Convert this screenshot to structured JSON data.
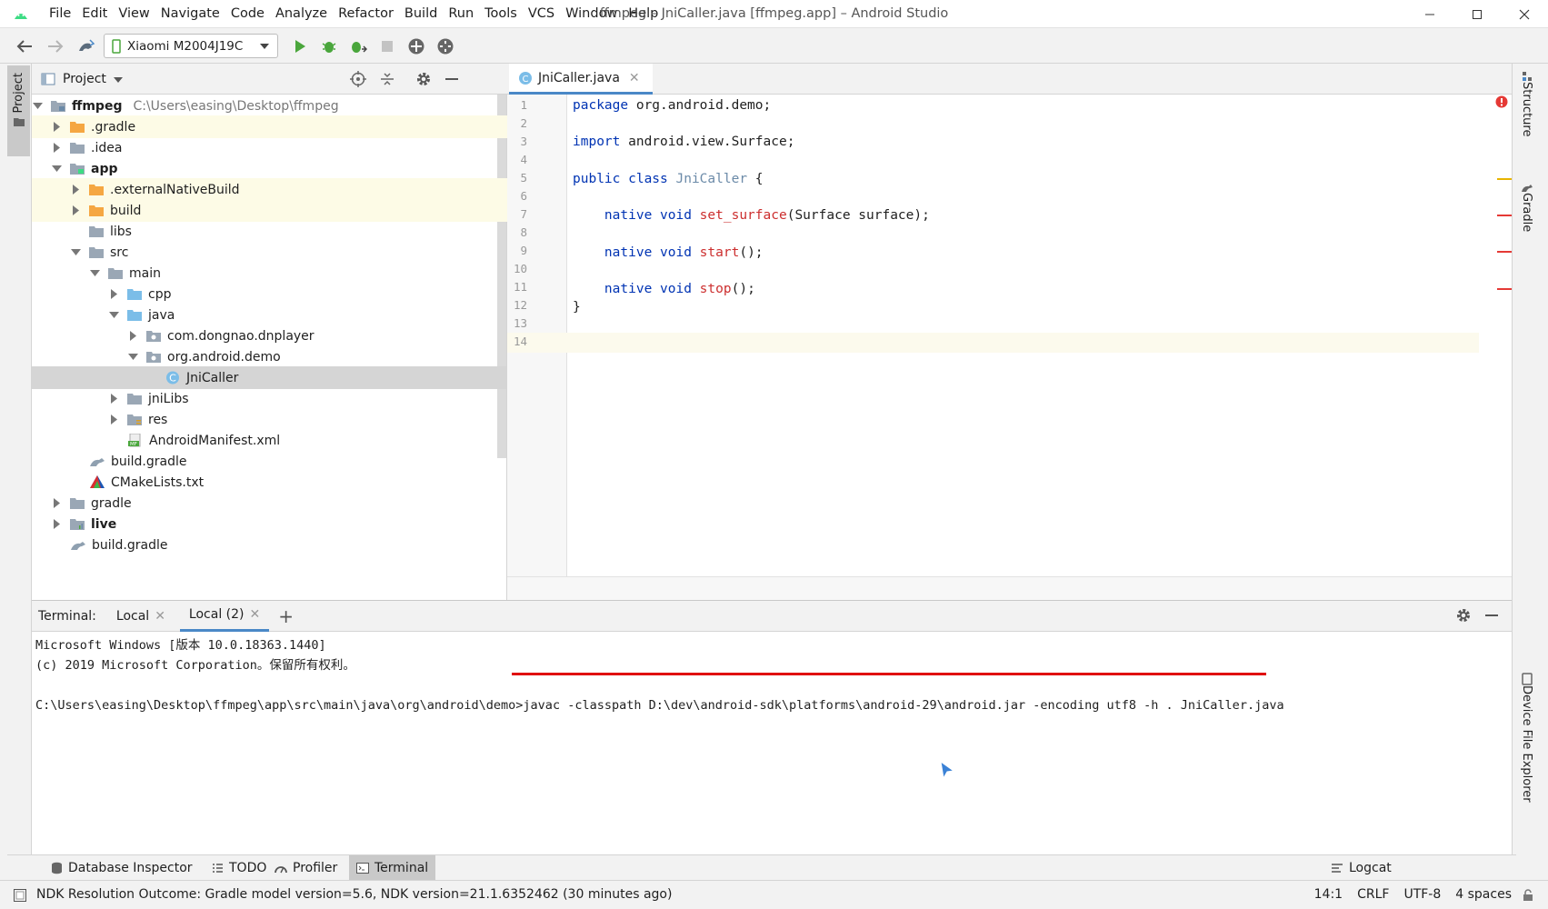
{
  "window": {
    "title": "ffmpeg – JniCaller.java [ffmpeg.app] – Android Studio"
  },
  "menu": [
    "File",
    "Edit",
    "View",
    "Navigate",
    "Code",
    "Analyze",
    "Refactor",
    "Build",
    "Run",
    "Tools",
    "VCS",
    "Window",
    "Help"
  ],
  "toolbar": {
    "device": "Xiaomi M2004J19C"
  },
  "left_strip": {
    "project_tab": "Project"
  },
  "project": {
    "title": "Project",
    "root_name": "ffmpeg",
    "root_path": "C:\\Users\\easing\\Desktop\\ffmpeg",
    "items": [
      ".gradle",
      ".idea",
      "app",
      ".externalNativeBuild",
      "build",
      "libs",
      "src",
      "main",
      "cpp",
      "java",
      "com.dongnao.dnplayer",
      "org.android.demo",
      "JniCaller",
      "jniLibs",
      "res",
      "AndroidManifest.xml",
      "build.gradle",
      "CMakeLists.txt",
      "gradle",
      "live",
      "build.gradle"
    ]
  },
  "editor": {
    "tab": "JniCaller.java",
    "line_numbers": [
      "1",
      "2",
      "3",
      "4",
      "5",
      "6",
      "7",
      "8",
      "9",
      "10",
      "11",
      "12",
      "13",
      "14"
    ],
    "code": {
      "l1_kw": "package",
      "l1_rest": " org.android.demo;",
      "l3_kw": "import",
      "l3_rest": " android.view.Surface;",
      "l5_kw": "public class",
      "l5_cls": " JniCaller",
      "l5_rest": " {",
      "l7_kw": "    native void",
      "l7_fn": " set_surface",
      "l7_rest": "(Surface surface);",
      "l9_kw": "    native void",
      "l9_fn": " start",
      "l9_rest": "();",
      "l11_kw": "    native void",
      "l11_fn": " stop",
      "l11_rest": "();",
      "l12": "}"
    }
  },
  "right_strip": {
    "structure": "Structure",
    "gradle": "Gradle",
    "device_file_explorer": "Device File Explorer"
  },
  "terminal": {
    "title": "Terminal:",
    "tabs": [
      "Local",
      "Local (2)"
    ],
    "lines": [
      "Microsoft Windows [版本 10.0.18363.1440]",
      "(c) 2019 Microsoft Corporation。保留所有权利。",
      "",
      "C:\\Users\\easing\\Desktop\\ffmpeg\\app\\src\\main\\java\\org\\android\\demo>javac -classpath D:\\dev\\android-sdk\\platforms\\android-29\\android.jar -encoding utf8 -h . JniCaller.java"
    ]
  },
  "bottom_tabs": [
    "Database Inspector",
    "TODO",
    "Profiler",
    "Terminal"
  ],
  "logcat": "Logcat",
  "status": {
    "message": "NDK Resolution Outcome: Gradle model version=5.6, NDK version=21.1.6352462 (30 minutes ago)",
    "position": "14:1",
    "line_sep": "CRLF",
    "encoding": "UTF-8",
    "indent": "4 spaces"
  },
  "colors": {
    "accent": "#4a88c7",
    "keyword": "#0033b3",
    "function": "#cc2e2e",
    "annotation_underline": "#e01010",
    "folder": "#f5a742"
  }
}
